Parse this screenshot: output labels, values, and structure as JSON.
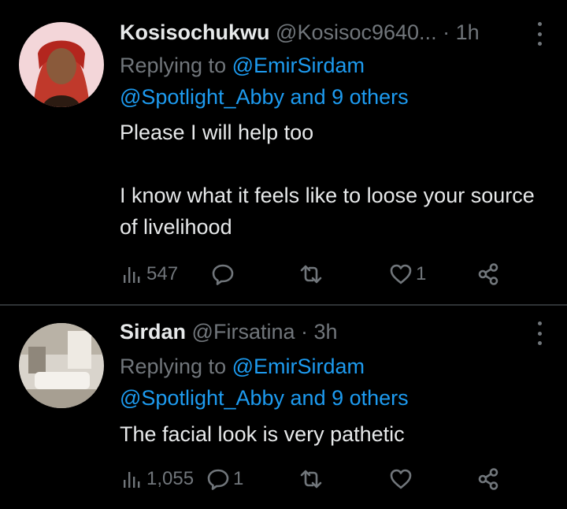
{
  "tweets": [
    {
      "name": "Kosisochukwu",
      "handle": "@Kosisoc9640...",
      "dot": "·",
      "time": "1h",
      "replying_prefix": "Replying to ",
      "replying_to": "@EmirSirdam",
      "mentions": "@Spotlight_Abby and 9 others",
      "text": "Please I will help too\n\nI know what it feels like to loose your source of livelihood",
      "views": "547",
      "replies": "",
      "retweets": "",
      "likes": "1"
    },
    {
      "name": "Sirdan",
      "handle": "@Firsatina",
      "dot": "·",
      "time": "3h",
      "replying_prefix": "Replying to ",
      "replying_to": "@EmirSirdam",
      "mentions": "@Spotlight_Abby and 9 others",
      "text": "The facial look is very pathetic",
      "views": "1,055",
      "replies": "1",
      "retweets": "",
      "likes": ""
    }
  ],
  "icons": {
    "views": "bar-chart-icon",
    "reply": "speech-bubble-icon",
    "retweet": "retweet-icon",
    "like": "heart-icon",
    "share": "share-icon",
    "more": "more-vertical-icon"
  },
  "colors": {
    "background": "#000000",
    "text": "#e7e9ea",
    "muted": "#71767b",
    "link": "#1d9bf0",
    "divider": "#2f3336"
  }
}
